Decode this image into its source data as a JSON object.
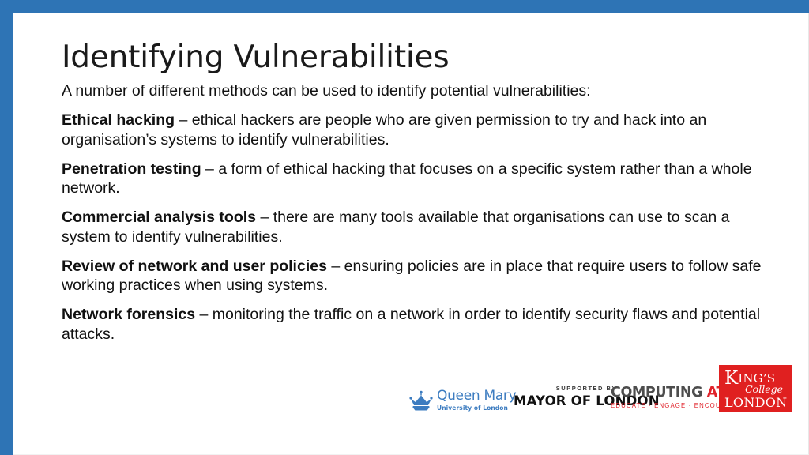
{
  "slide": {
    "title": "Identifying Vulnerabilities",
    "intro": "A number of different methods can be used to identify potential vulnerabilities:",
    "methods": [
      {
        "term": "Ethical hacking",
        "description": " – ethical hackers are people who are given permission to try and hack into an organisation’s systems to identify vulnerabilities."
      },
      {
        "term": "Penetration testing",
        "description": " – a form of ethical hacking that focuses on a specific system rather than a whole network."
      },
      {
        "term": "Commercial analysis tools",
        "description": " – there are many tools available that organisations can use to scan a system to identify vulnerabilities."
      },
      {
        "term": "Review of network and user policies",
        "description": " – ensuring policies are in place that require users to follow safe working practices when using systems."
      },
      {
        "term": "Network forensics",
        "description": " – monitoring the traffic on a network in order to identify security flaws and potential attacks."
      }
    ]
  },
  "logos": {
    "queen_mary": {
      "name": "Queen Mary",
      "subtitle": "University of London",
      "color": "#3c7cc0"
    },
    "mayor_of_london": {
      "supported_by": "SUPPORTED BY",
      "name": "MAYOR OF LONDON",
      "color": "#111111"
    },
    "computing_at_school": {
      "name_part1": "COMPUTING ",
      "name_part2": "AT SCHOOL",
      "tagline": "EDUCATE · ENGAGE · ENCOURAGE",
      "grey": "#4d4d4d",
      "red": "#e0232b"
    },
    "kings_college": {
      "k": "K",
      "ings": "ING’S",
      "college": "College",
      "london": "LONDON",
      "background": "#e02020"
    }
  },
  "theme": {
    "accent_blue": "#2e74b5",
    "background": "#ffffff",
    "text": "#111111"
  }
}
